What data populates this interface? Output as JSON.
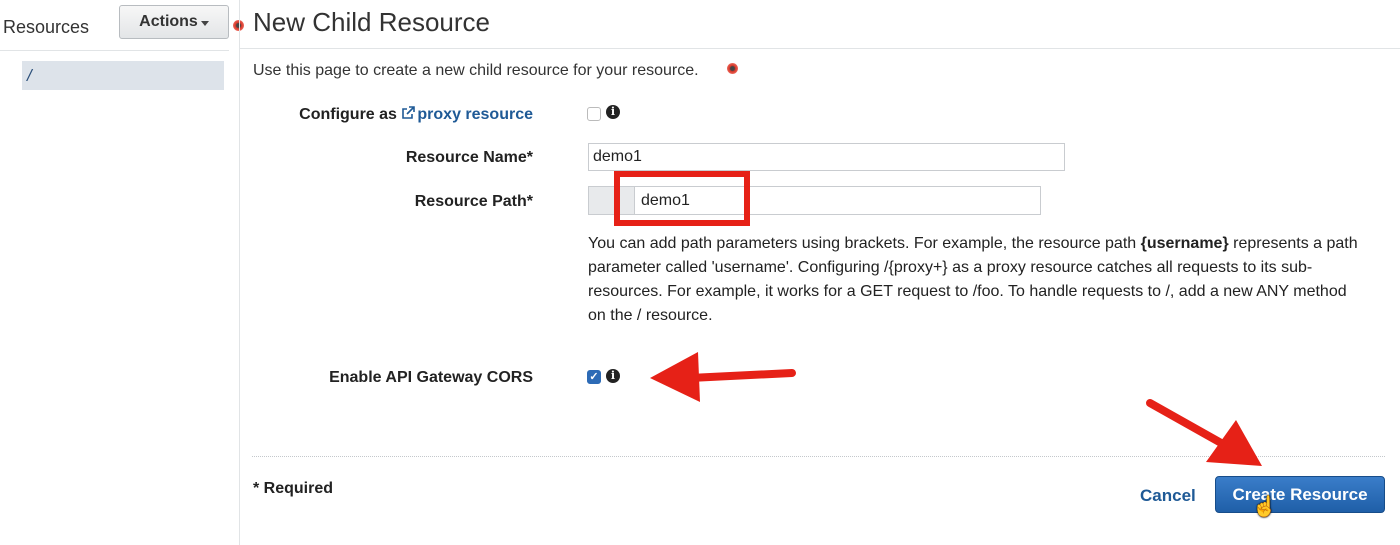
{
  "sidebar": {
    "title": "Resources",
    "actions_label": "Actions",
    "root_item": "/"
  },
  "header": {
    "title": "New Child Resource",
    "description": "Use this page to create a new child resource for your resource."
  },
  "form": {
    "proxy": {
      "label_prefix": "Configure as ",
      "link_text": "proxy resource",
      "checked": false
    },
    "resource_name": {
      "label": "Resource Name*",
      "value": "demo1"
    },
    "resource_path": {
      "label": "Resource Path*",
      "value": "demo1",
      "help_1": "You can add path parameters using brackets. For example, the resource path ",
      "help_bold": "{username}",
      "help_2": " represents a path parameter called 'username'. Configuring /{proxy+} as a proxy resource catches all requests to its sub-resources. For example, it works for a GET request to /foo. To handle requests to /, add a new ANY method on the / resource."
    },
    "cors": {
      "label": "Enable API Gateway CORS",
      "checked": true
    },
    "required_note": "* Required"
  },
  "buttons": {
    "cancel": "Cancel",
    "create": "Create Resource"
  },
  "icons": {
    "info": "info-icon",
    "external_link": "external-link-icon",
    "caret": "caret-down-icon",
    "cursor": "hand-pointer-icon"
  },
  "colors": {
    "primary": "#1f5fa8",
    "link": "#1f5a96",
    "highlight": "#e62117",
    "selected_bg": "#dde3ea"
  }
}
